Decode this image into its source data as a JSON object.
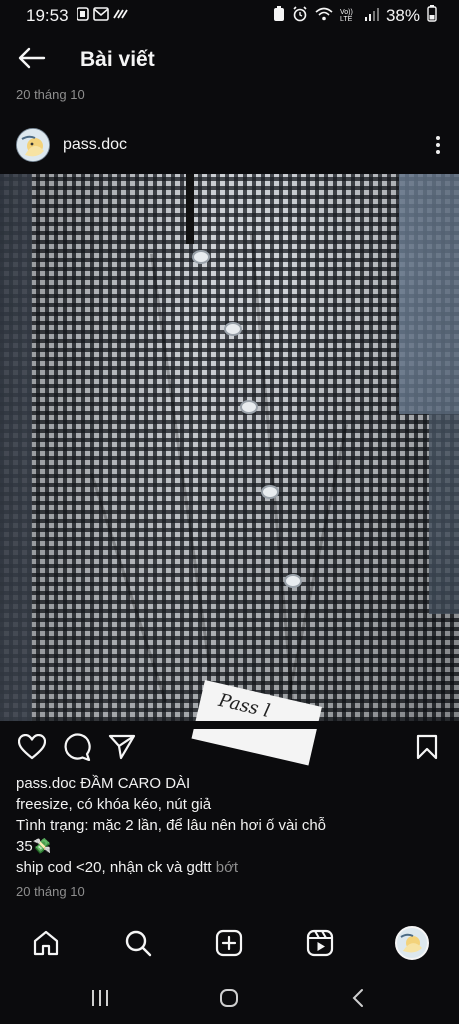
{
  "status_bar": {
    "time": "19:53",
    "network": "Vo)) LTE",
    "battery": "38%"
  },
  "header": {
    "title": "Bài viết"
  },
  "post": {
    "date_top": "20 tháng 10",
    "author": "pass.doc",
    "image": {
      "tag_text": "Pass l"
    },
    "caption": {
      "username": "pass.doc",
      "title_line": "ĐẦM CARO DÀI",
      "line2": "freesize, có khóa kéo, nút giả",
      "line3": "Tình trạng: mặc 2 lần, để lâu nên hơi ố vài chỗ",
      "line4": "35💸",
      "line5": "ship cod <20, nhận ck và gdtt",
      "more_label": "bớt"
    },
    "date_bottom": "20 tháng 10"
  },
  "icons": {
    "back": "arrow-left-icon",
    "more": "more-vertical-icon",
    "like": "heart-icon",
    "comment": "comment-icon",
    "share": "send-icon",
    "save": "bookmark-icon",
    "home": "home-icon",
    "search": "search-icon",
    "create": "add-square-icon",
    "reels": "reels-icon",
    "profile": "avatar-icon"
  },
  "colors": {
    "background": "#0b0b0d",
    "secondary_text": "#8e8e8e",
    "primary_text": "#f5f5f5"
  }
}
